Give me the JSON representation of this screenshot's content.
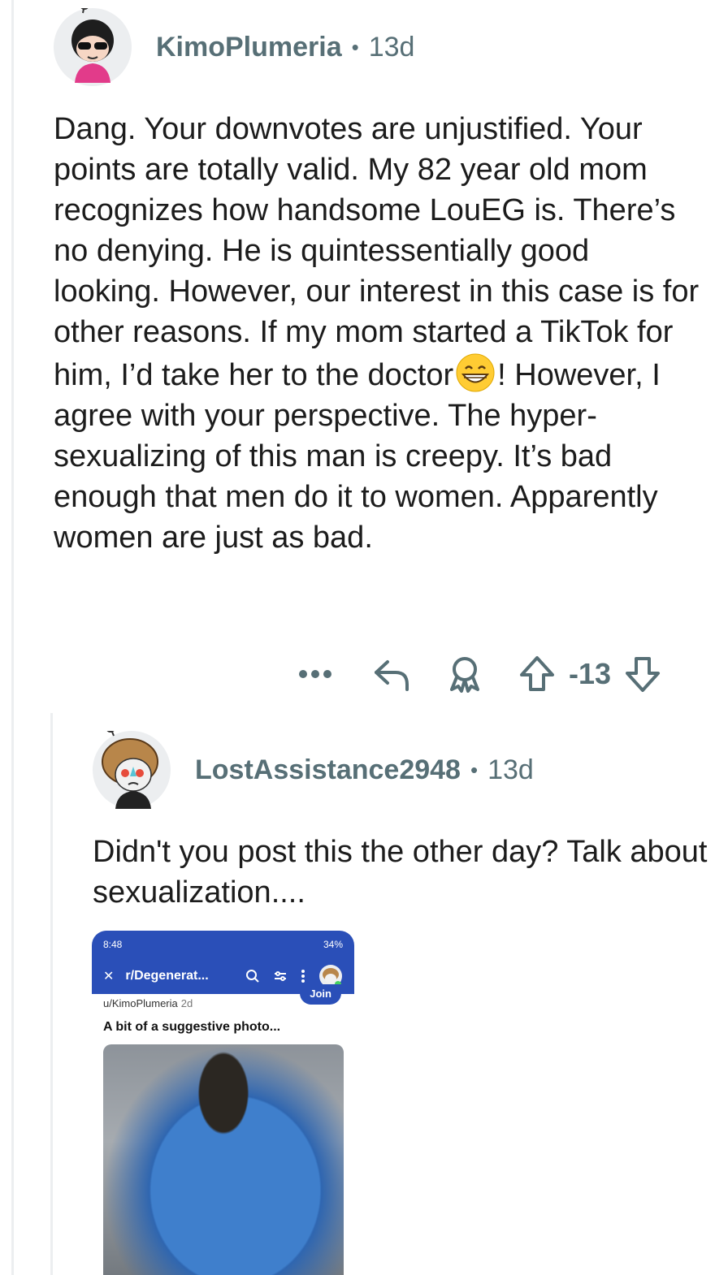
{
  "comment1": {
    "username": "KimoPlumeria",
    "age": "13d",
    "separator": "•",
    "body_part1": "Dang. Your downvotes are unjustified. Your points are totally valid. My 82 year old mom recognizes how handsome LouEG is. There’s no denying. He is quintessentially good looking. However, our interest in this case is for other reasons. If my mom started a TikTok for him, I’d take her to the doctor",
    "body_emoji": "grinning-face-emoji",
    "body_part2": "! However, I agree with your perspective. The hyper-sexualizing of this man is creepy. It’s bad enough that men do it to women. Apparently women are just as bad.",
    "score": "-13",
    "actions": [
      "more-icon",
      "reply-icon",
      "award-icon",
      "upvote-icon",
      "downvote-icon"
    ]
  },
  "comment2": {
    "username": "LostAssistance2948",
    "age": "13d",
    "separator": "•",
    "body": "Didn't you post this the other day? Talk about sexualization...."
  },
  "embed": {
    "status_time": "8:48",
    "status_battery": "34%",
    "subreddit": "r/Degenerat...",
    "join_label": "Join",
    "post_user": "u/KimoPlumeria",
    "post_age": "2d",
    "post_title": "A bit of a suggestive photo..."
  },
  "colors": {
    "meta": "#576f76",
    "text": "#1c1c1c",
    "embed_bar": "#2a4fb8",
    "thread_line": "#eceef0"
  }
}
